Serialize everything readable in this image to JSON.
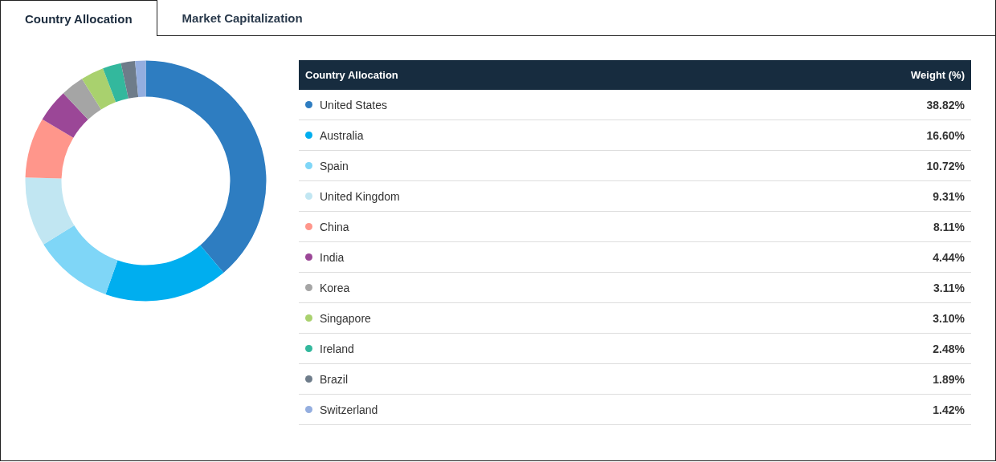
{
  "tabs": [
    {
      "label": "Country Allocation",
      "selected": true
    },
    {
      "label": "Market Capitalization",
      "selected": false
    }
  ],
  "table": {
    "columns": [
      "Country Allocation",
      "Weight (%)"
    ],
    "rows": [
      {
        "country": "United States",
        "weight": "38.82%",
        "color": "#2e7dc1"
      },
      {
        "country": "Australia",
        "weight": "16.60%",
        "color": "#00aeef"
      },
      {
        "country": "Spain",
        "weight": "10.72%",
        "color": "#7fd6f7"
      },
      {
        "country": "United Kingdom",
        "weight": "9.31%",
        "color": "#c1e6f2"
      },
      {
        "country": "China",
        "weight": "8.11%",
        "color": "#ff968b"
      },
      {
        "country": "India",
        "weight": "4.44%",
        "color": "#9b4797"
      },
      {
        "country": "Korea",
        "weight": "3.11%",
        "color": "#a5a5a5"
      },
      {
        "country": "Singapore",
        "weight": "3.10%",
        "color": "#a9d16e"
      },
      {
        "country": "Ireland",
        "weight": "2.48%",
        "color": "#33b89d"
      },
      {
        "country": "Brazil",
        "weight": "1.89%",
        "color": "#6e7c8a"
      },
      {
        "country": "Switzerland",
        "weight": "1.42%",
        "color": "#94aedf"
      }
    ]
  },
  "chart_data": {
    "type": "donut",
    "series": [
      {
        "values": [
          38.82,
          16.6,
          10.72,
          9.31,
          8.11,
          4.44,
          3.11,
          3.1,
          2.48,
          1.89,
          1.42
        ]
      }
    ]
  }
}
